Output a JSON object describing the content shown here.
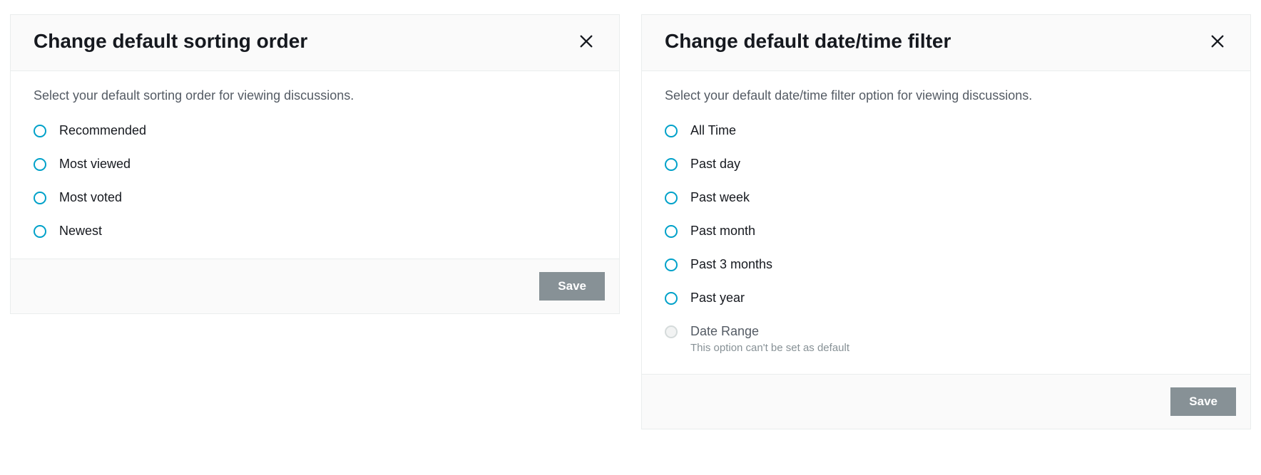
{
  "sorting_modal": {
    "title": "Change default sorting order",
    "prompt": "Select your default sorting order for viewing discussions.",
    "options": [
      {
        "label": "Recommended"
      },
      {
        "label": "Most viewed"
      },
      {
        "label": "Most voted"
      },
      {
        "label": "Newest"
      }
    ],
    "save_label": "Save"
  },
  "datetime_modal": {
    "title": "Change default date/time filter",
    "prompt": "Select your default date/time filter option for viewing discussions.",
    "options": [
      {
        "label": "All Time"
      },
      {
        "label": "Past day"
      },
      {
        "label": "Past week"
      },
      {
        "label": "Past month"
      },
      {
        "label": "Past 3 months"
      },
      {
        "label": "Past year"
      },
      {
        "label": "Date Range",
        "disabled": true,
        "sub": "This option can't be set as default"
      }
    ],
    "save_label": "Save"
  }
}
